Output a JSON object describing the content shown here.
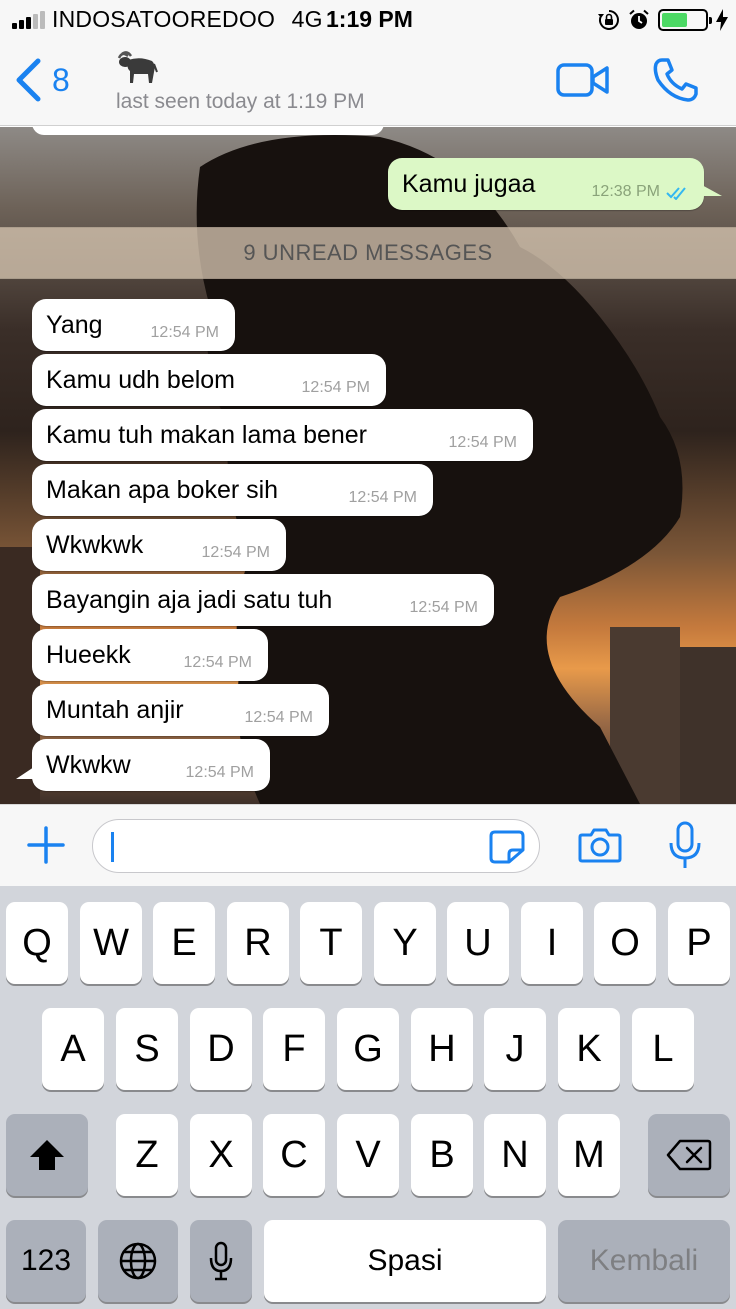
{
  "status_bar": {
    "carrier": "INDOSATOOREDOO",
    "network": "4G",
    "time": "1:19 PM",
    "battery_level": 0.6,
    "icons": [
      "signal-icon",
      "rotation-lock-icon",
      "alarm-icon",
      "battery-icon",
      "charging-icon"
    ]
  },
  "header": {
    "back_count": "8",
    "contact_emoji": "🐃",
    "status": "last seen today at 1:19 PM",
    "icons": [
      "back-chevron-icon",
      "video-call-icon",
      "phone-call-icon"
    ]
  },
  "colors": {
    "accent": "#1a82f0",
    "outgoing_bubble": "#dcf8c6",
    "incoming_bubble": "#ffffff",
    "read_ticks": "#34b7f1"
  },
  "chat": {
    "outgoing": {
      "text": "Kamu jugaa",
      "time": "12:38 PM",
      "status": "read"
    },
    "unread_banner": "9 UNREAD MESSAGES",
    "messages": [
      {
        "text": "Yang",
        "time": "12:54 PM"
      },
      {
        "text": "Kamu udh belom",
        "time": "12:54 PM"
      },
      {
        "text": "Kamu tuh makan lama bener",
        "time": "12:54 PM"
      },
      {
        "text": "Makan apa boker sih",
        "time": "12:54 PM"
      },
      {
        "text": "Wkwkwk",
        "time": "12:54 PM"
      },
      {
        "text": "Bayangin aja jadi satu tuh",
        "time": "12:54 PM"
      },
      {
        "text": "Hueekk",
        "time": "12:54 PM"
      },
      {
        "text": "Muntah anjir",
        "time": "12:54 PM"
      },
      {
        "text": "Wkwkw",
        "time": "12:54 PM"
      }
    ]
  },
  "input_bar": {
    "message_value": "",
    "icons": [
      "plus-icon",
      "sticker-icon",
      "camera-icon",
      "microphone-icon"
    ]
  },
  "keyboard": {
    "row1": [
      "Q",
      "W",
      "E",
      "R",
      "T",
      "Y",
      "U",
      "I",
      "O",
      "P"
    ],
    "row2": [
      "A",
      "S",
      "D",
      "F",
      "G",
      "H",
      "J",
      "K",
      "L"
    ],
    "row3": [
      "Z",
      "X",
      "C",
      "V",
      "B",
      "N",
      "M"
    ],
    "numbers_label": "123",
    "space_label": "Spasi",
    "return_label": "Kembali",
    "icons": [
      "shift-icon",
      "backspace-icon",
      "globe-icon",
      "dictation-mic-icon"
    ]
  }
}
